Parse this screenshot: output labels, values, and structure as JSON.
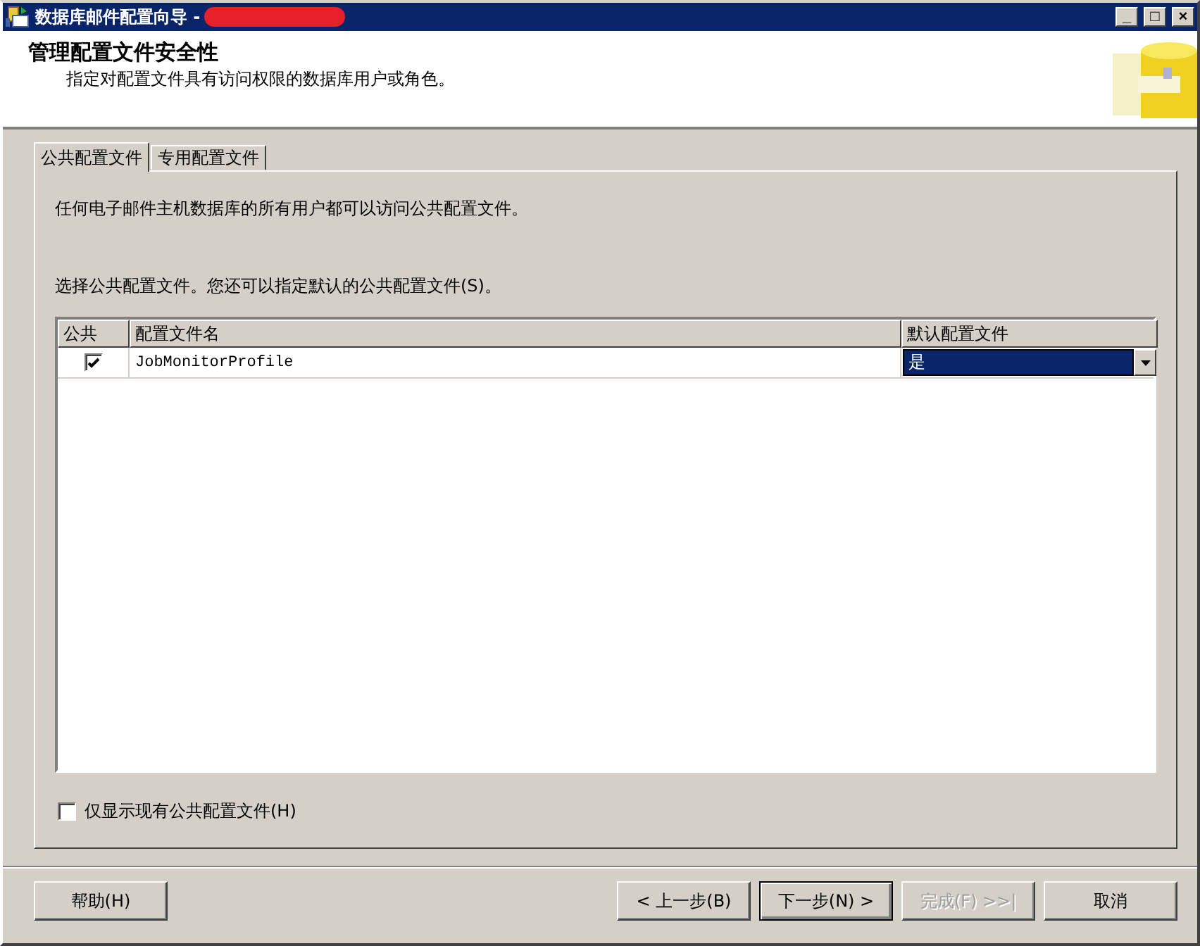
{
  "window": {
    "title": "数据库邮件配置向导 -",
    "redacted": true,
    "controls": [
      "_",
      "□",
      "×"
    ]
  },
  "header": {
    "title": "管理配置文件安全性",
    "subtitle": "指定对配置文件具有访问权限的数据库用户或角色。"
  },
  "tabs": [
    {
      "label": "公共配置文件",
      "selected": true
    },
    {
      "label": "专用配置文件",
      "selected": false
    }
  ],
  "description": "任何电子邮件主机数据库的所有用户都可以访问公共配置文件。",
  "instruction": "选择公共配置文件。您还可以指定默认的公共配置文件(S)。",
  "table": {
    "columns": [
      "公共",
      "配置文件名",
      "默认配置文件"
    ],
    "rows": [
      {
        "public": true,
        "name": "JobMonitorProfile",
        "default": "是",
        "highlighted": true
      }
    ]
  },
  "show_existing": {
    "label": "仅显示现有公共配置文件(H)",
    "checked": false
  },
  "buttons": [
    {
      "label": "帮助(H)",
      "disabled": false,
      "default": false,
      "kind": "aside"
    },
    {
      "label": "< 上一步(B)",
      "disabled": false,
      "default": false,
      "kind": "nav"
    },
    {
      "label": "下一步(N) >",
      "disabled": false,
      "default": true,
      "kind": "nav"
    },
    {
      "label": "完成(F) >>|",
      "disabled": true,
      "default": false,
      "kind": "nav"
    },
    {
      "label": "取消",
      "disabled": false,
      "default": false,
      "kind": "nav"
    }
  ]
}
